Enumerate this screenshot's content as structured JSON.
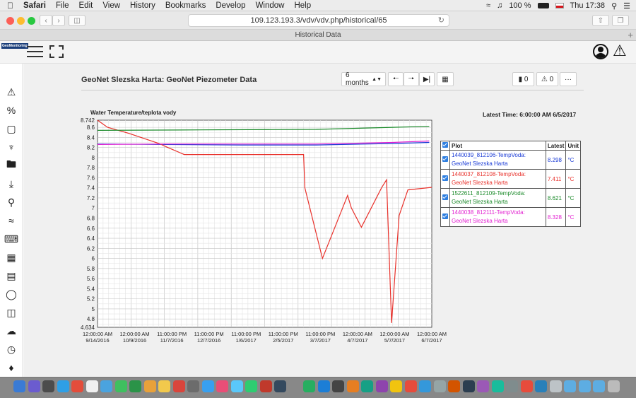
{
  "menubar": {
    "app": "Safari",
    "items": [
      "File",
      "Edit",
      "View",
      "History",
      "Bookmarks",
      "Develop",
      "Window",
      "Help"
    ],
    "battery": "100 %",
    "day_time": "Thu 17:38"
  },
  "browser": {
    "url": "109.123.193.3/vdv/vdv.php/historical/65",
    "tab_title": "Historical Data"
  },
  "app_header": {
    "logo_text": "GeoMonitoring"
  },
  "page": {
    "title": "GeoNet Slezska Harta: GeoNet Piezometer Data",
    "range_select": "6 months",
    "messages_count": "0",
    "alerts_count": "0",
    "more_label": "···"
  },
  "chart": {
    "latest_time_label": "Latest Time: 6:00:00 AM 6/5/2017"
  },
  "legend": {
    "headers": [
      "Plot",
      "Latest",
      "Unit"
    ],
    "rows": [
      {
        "name": "1440039_812106-TempVoda: GeoNet Slezska Harta",
        "latest": "8.298",
        "unit": "°C",
        "color": "#1a3bd6"
      },
      {
        "name": "1440037_812108-TempVoda: GeoNet Slezska Harta",
        "latest": "7.411",
        "unit": "°C",
        "color": "#e8302a"
      },
      {
        "name": "1522611_812109-TempVoda: GeoNet Slezska Harta",
        "latest": "8.621",
        "unit": "°C",
        "color": "#1b8a2a"
      },
      {
        "name": "1440038_812111-TempVoda: GeoNet Slezska Harta",
        "latest": "8.328",
        "unit": "°C",
        "color": "#e21fd0"
      }
    ]
  },
  "chart_data": {
    "type": "line",
    "title": "Water Temperature/teplota vody",
    "ylim": [
      4.634,
      8.742
    ],
    "y_ticks": [
      "8.742",
      "8.6",
      "8.4",
      "8.2",
      "8",
      "7.8",
      "7.6",
      "7.4",
      "7.2",
      "7",
      "6.8",
      "6.6",
      "6.4",
      "6.2",
      "6",
      "5.8",
      "5.6",
      "5.4",
      "5.2",
      "5",
      "4.8",
      "4.634"
    ],
    "x_ticks": [
      {
        "time": "12:00:00 AM",
        "date": "9/14/2016"
      },
      {
        "time": "12:00:00 AM",
        "date": "10/9/2016"
      },
      {
        "time": "11:00:00 PM",
        "date": "11/7/2016"
      },
      {
        "time": "11:00:00 PM",
        "date": "12/7/2016"
      },
      {
        "time": "11:00:00 PM",
        "date": "1/6/2017"
      },
      {
        "time": "11:00:00 PM",
        "date": "2/5/2017"
      },
      {
        "time": "11:00:00 PM",
        "date": "3/7/2017"
      },
      {
        "time": "12:00:00 AM",
        "date": "4/7/2017"
      },
      {
        "time": "12:00:00 AM",
        "date": "5/7/2017"
      },
      {
        "time": "12:00:00 AM",
        "date": "6/7/2017"
      }
    ],
    "x_range": [
      "2016-09-14",
      "2017-06-07"
    ],
    "series": [
      {
        "name": "1440039_812106-TempVoda: GeoNet Slezska Harta",
        "color": "#1a3bd6",
        "x": [
          "2016-09-14",
          "2016-11-07",
          "2017-01-06",
          "2017-03-07",
          "2017-05-07",
          "2017-06-05"
        ],
        "values": [
          8.27,
          8.26,
          8.25,
          8.25,
          8.28,
          8.3
        ]
      },
      {
        "name": "1440037_812108-TempVoda: GeoNet Slezska Harta",
        "color": "#e8302a",
        "x": [
          "2016-09-14",
          "2016-09-22",
          "2016-10-09",
          "2016-11-02",
          "2016-11-09",
          "2016-11-22",
          "2017-02-25",
          "2017-02-26",
          "2017-03-05",
          "2017-03-12",
          "2017-04-01",
          "2017-04-04",
          "2017-04-12",
          "2017-04-28",
          "2017-05-02",
          "2017-05-06",
          "2017-05-12",
          "2017-05-19",
          "2017-06-07"
        ],
        "values": [
          8.742,
          8.6,
          8.48,
          8.28,
          8.2,
          8.06,
          8.06,
          7.4,
          6.7,
          6.0,
          7.25,
          7.0,
          6.62,
          7.4,
          7.56,
          4.72,
          6.85,
          7.36,
          7.41
        ]
      },
      {
        "name": "1522611_812109-TempVoda: GeoNet Slezska Harta",
        "color": "#1b8a2a",
        "x": [
          "2016-09-14",
          "2016-12-07",
          "2017-03-07",
          "2017-05-07",
          "2017-06-05"
        ],
        "values": [
          8.54,
          8.55,
          8.56,
          8.6,
          8.62
        ]
      },
      {
        "name": "1440038_812111-TempVoda: GeoNet Slezska Harta",
        "color": "#e21fd0",
        "x": [
          "2016-09-14",
          "2016-11-07",
          "2017-01-06",
          "2017-03-07",
          "2017-05-07",
          "2017-06-05"
        ],
        "values": [
          8.26,
          8.27,
          8.27,
          8.27,
          8.3,
          8.33
        ]
      }
    ]
  }
}
